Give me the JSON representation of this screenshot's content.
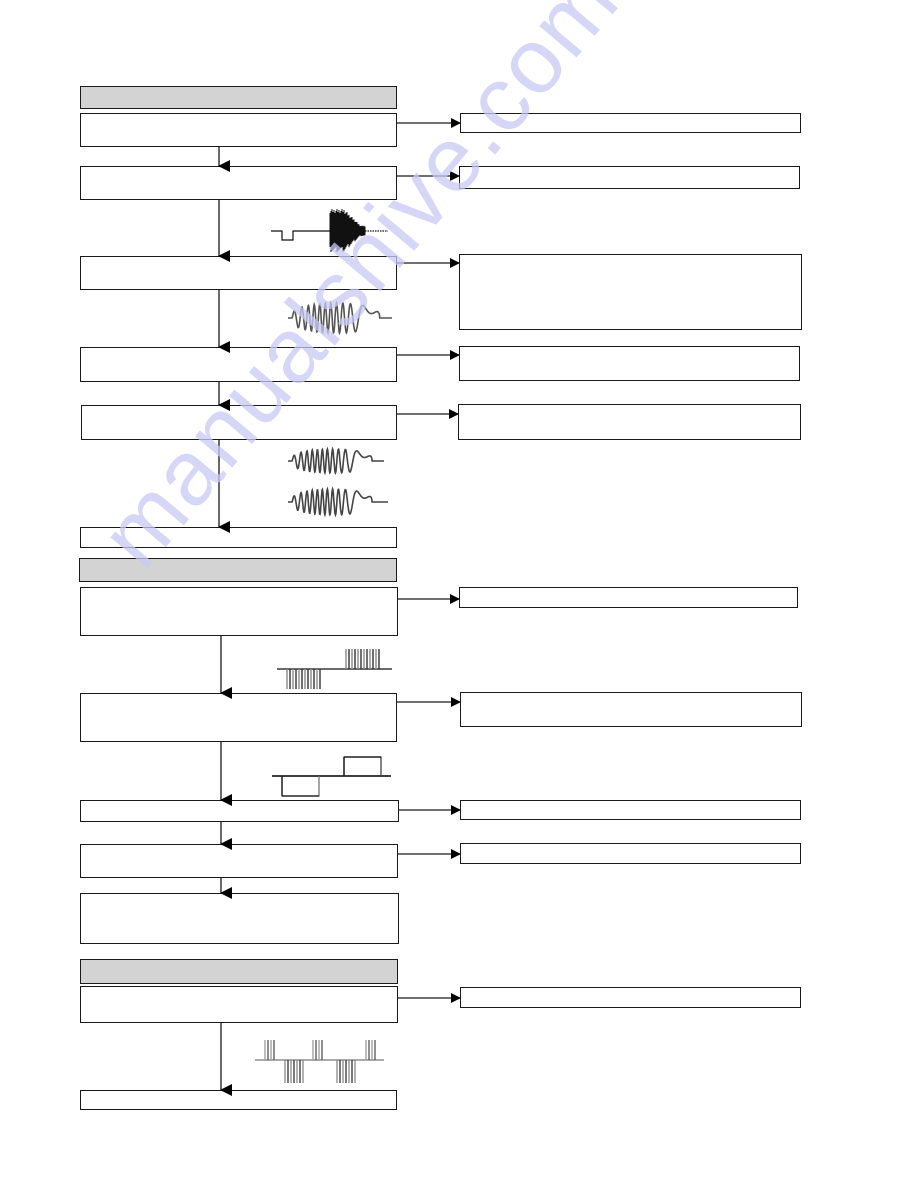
{
  "diagram": {
    "type": "flowchart",
    "text_labels_visible": false,
    "sections": [
      {
        "id": "section-1",
        "header": "",
        "steps": 6,
        "side_boxes": 5
      },
      {
        "id": "section-2",
        "header": "",
        "steps": 5,
        "side_boxes": 4
      },
      {
        "id": "section-3",
        "header": "",
        "steps": 2,
        "side_boxes": 1
      }
    ],
    "waveforms": [
      {
        "name": "pulse-then-burst",
        "section": 1
      },
      {
        "name": "sinusoid-burst",
        "section": 1
      },
      {
        "name": "sinusoid-burst-pair",
        "section": 1
      },
      {
        "name": "bipolar-pulse-burst",
        "section": 2
      },
      {
        "name": "bipolar-square-pulse",
        "section": 2
      },
      {
        "name": "alternating-pulse-train",
        "section": 3
      }
    ]
  },
  "colors": {
    "line": "#1a1a1a",
    "header_fill": "#d3d3d3",
    "watermark": "#c9c9f5"
  },
  "watermark": {
    "text": "manualshive.com"
  }
}
